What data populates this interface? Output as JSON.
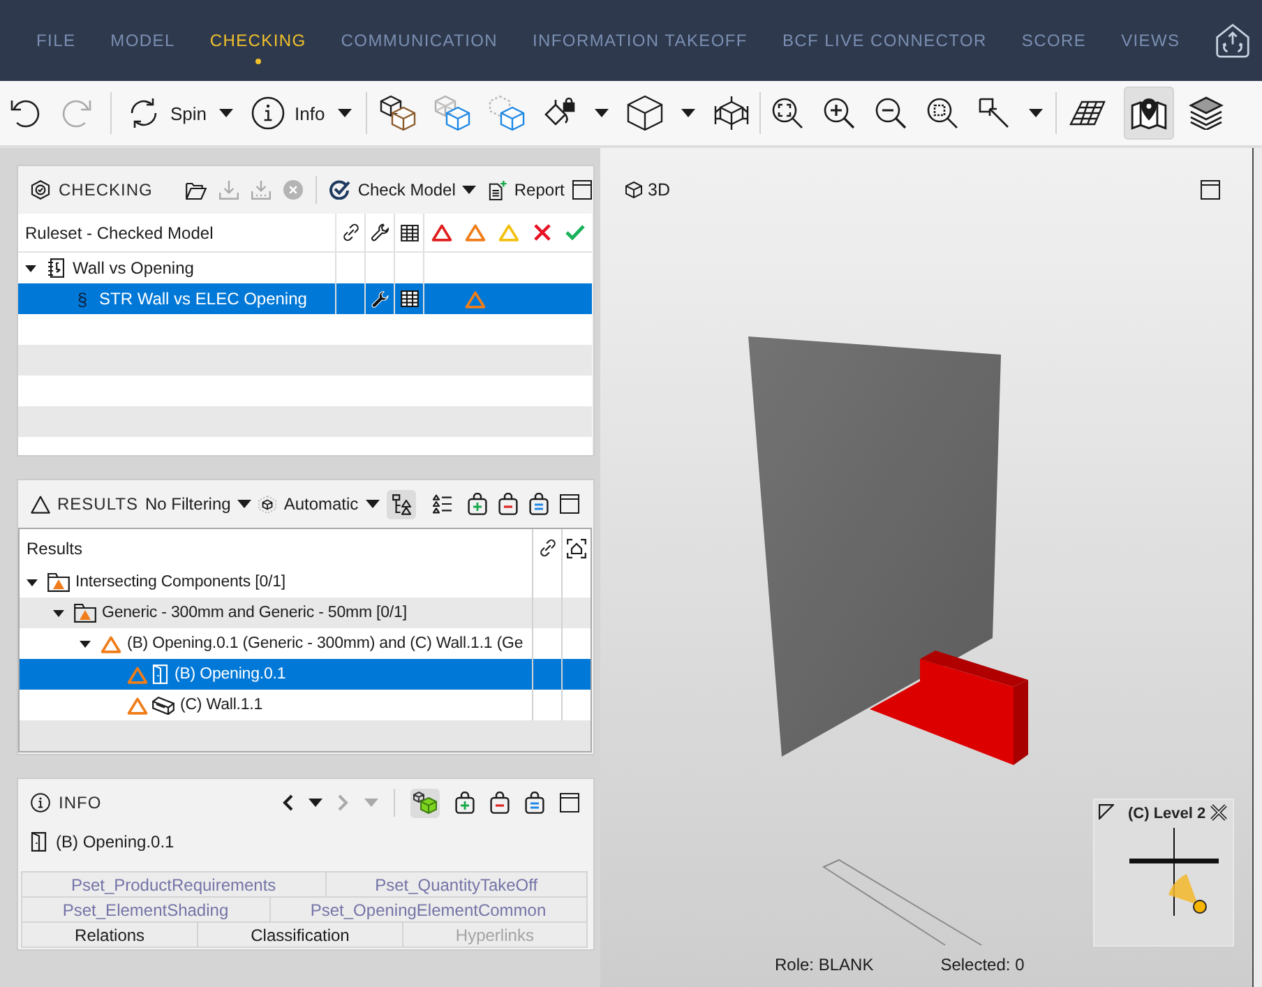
{
  "menu": [
    {
      "label": "FILE",
      "selected": false
    },
    {
      "label": "MODEL",
      "selected": false
    },
    {
      "label": "CHECKING",
      "selected": true
    },
    {
      "label": "COMMUNICATION",
      "selected": false
    },
    {
      "label": "INFORMATION TAKEOFF",
      "selected": false
    },
    {
      "label": "BCF LIVE CONNECTOR",
      "selected": false
    },
    {
      "label": "SCORE",
      "selected": false
    },
    {
      "label": "VIEWS",
      "selected": false
    }
  ],
  "toolbar": {
    "undo": {
      "disabled": false
    },
    "redo": {
      "disabled": true
    },
    "spin": {
      "label": "Spin"
    },
    "info": {
      "label": "Info"
    },
    "map_view": {
      "pressed": true
    },
    "layers": {
      "pressed": false
    }
  },
  "checking": {
    "title": "CHECKING",
    "tools": {
      "open": {
        "disabled": false
      },
      "download": {
        "disabled": true
      },
      "download_all": {
        "disabled": true
      },
      "cancel": {
        "disabled": true
      }
    },
    "check_model": "Check Model",
    "report": "Report",
    "column_header": "Ruleset - Checked Model",
    "rows": [
      {
        "kind": "ruleset",
        "label": "Wall vs Opening",
        "expanded": true,
        "selected": false,
        "settings": false,
        "table": false,
        "critical": false,
        "moderate": false,
        "low": false,
        "rejected": false,
        "accepted": false,
        "children": [
          {
            "kind": "rule",
            "symbol": "§",
            "label": "STR Wall vs ELEC Opening",
            "selected": true,
            "settings": true,
            "table": true,
            "critical": false,
            "moderate": true,
            "low": false,
            "rejected": false,
            "accepted": false
          }
        ]
      }
    ]
  },
  "results": {
    "title": "RESULTS",
    "filter": "No Filtering",
    "mode": "Automatic",
    "tree_view": {
      "pressed": true
    },
    "list_view": {
      "pressed": false
    },
    "column_header": "Results",
    "rows": [
      {
        "kind": "category",
        "label": "Intersecting Components [0/1]",
        "color": "#f07d1a",
        "expanded": true,
        "selected": false,
        "children": [
          {
            "kind": "category",
            "label": "Generic - 300mm and Generic - 50mm [0/1]",
            "color": "#f07d1a",
            "expanded": true,
            "selected": false,
            "children": [
              {
                "kind": "issue",
                "label": "(B) Opening.0.1 (Generic - 300mm) and (C) Wall.1.1 (Ge",
                "color": "#f07d1a",
                "expanded": true,
                "selected": false,
                "children": [
                  {
                    "kind": "opening",
                    "label": "(B) Opening.0.1",
                    "color": "#f07d1a",
                    "selected": true
                  },
                  {
                    "kind": "wall",
                    "label": "(C) Wall.1.1",
                    "color": "#f07d1a",
                    "selected": false
                  }
                ]
              }
            ]
          }
        ]
      }
    ]
  },
  "info": {
    "title": "INFO",
    "back": {
      "disabled": false
    },
    "forward": {
      "disabled": true
    },
    "cube_button": {
      "pressed": true
    },
    "selection": "(B) Opening.0.1",
    "tab_rows": [
      [
        {
          "label": "Pset_ProductRequirements",
          "kind": "property-set",
          "disabled": false
        },
        {
          "label": "Pset_QuantityTakeOff",
          "kind": "property-set",
          "disabled": false
        }
      ],
      [
        {
          "label": "Pset_ElementShading",
          "kind": "property-set",
          "disabled": false
        },
        {
          "label": "Pset_OpeningElementCommon",
          "kind": "property-set",
          "disabled": false
        }
      ],
      [
        {
          "label": "Relations",
          "kind": "standard",
          "disabled": false
        },
        {
          "label": "Classification",
          "kind": "standard",
          "disabled": false
        },
        {
          "label": "Hyperlinks",
          "kind": "standard",
          "disabled": true
        }
      ]
    ]
  },
  "viewport": {
    "title": "3D",
    "minimap": {
      "title": "(C) Level 2"
    },
    "status": [
      "Role: BLANK",
      "Selected: 0"
    ]
  }
}
